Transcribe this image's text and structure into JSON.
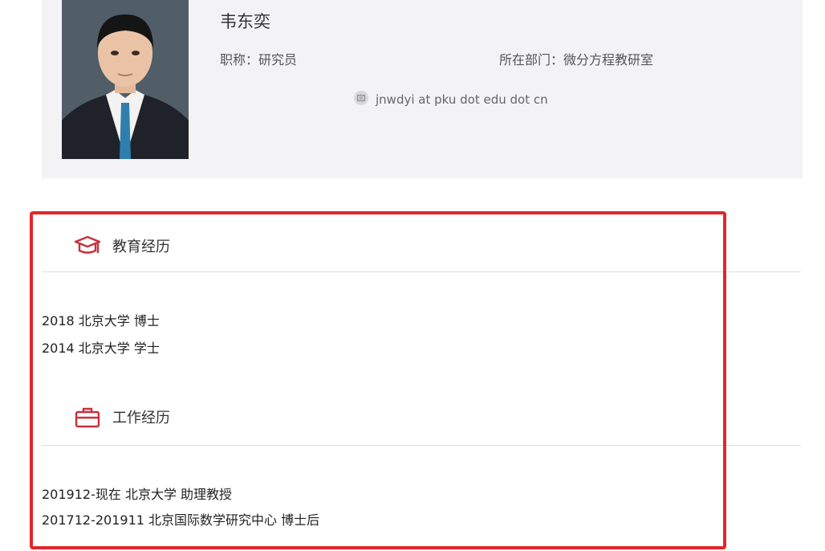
{
  "profile": {
    "name": "韦东奕",
    "title": "职称：研究员",
    "department": "所在部门：微分方程教研室",
    "email": "jnwdyi at pku dot edu dot cn",
    "email_icon": "mail-icon",
    "photo_alt": "韦东奕"
  },
  "education": {
    "icon": "graduation-cap-icon",
    "heading": "教育经历",
    "entries": [
      "2018 北京大学 博士",
      "2014 北京大学 学士"
    ]
  },
  "work": {
    "icon": "briefcase-icon",
    "heading": "工作经历",
    "entries": [
      "201912-现在 北京大学 助理教授",
      "201712-201911 北京国际数学研究中心 博士后"
    ]
  },
  "colors": {
    "accent_red": "#e3262b",
    "icon_red": "#c8313a",
    "card_background": "#f3f3f5"
  }
}
